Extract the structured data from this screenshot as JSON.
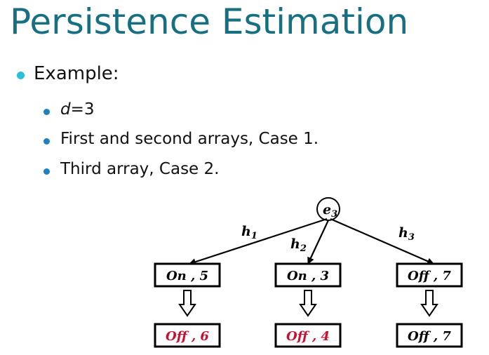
{
  "title": "Persistence Estimation",
  "bullets": {
    "example": "Example:",
    "d_var": "d",
    "d_rest": "=3",
    "case1": "First and second arrays, Case 1.",
    "case2": "Third array, Case 2."
  },
  "diagram": {
    "root_base": "e",
    "root_sub": "3",
    "edges": [
      {
        "base": "h",
        "sub": "1"
      },
      {
        "base": "h",
        "sub": "2"
      },
      {
        "base": "h",
        "sub": "3"
      }
    ],
    "top_boxes": [
      {
        "status": "On",
        "value": "5"
      },
      {
        "status": "On",
        "value": "3"
      },
      {
        "status": "Off",
        "value": "7"
      }
    ],
    "bottom_boxes": [
      {
        "status": "Off",
        "value": "6"
      },
      {
        "status": "Off",
        "value": "4"
      },
      {
        "status": "Off",
        "value": "7"
      }
    ],
    "separator": " , ",
    "colors": {
      "title": "#176f82",
      "bullet1": "#2bc0d9",
      "bullet2": "#1f7fbf",
      "changed": "#c8102e",
      "unchanged": "#000000"
    }
  }
}
